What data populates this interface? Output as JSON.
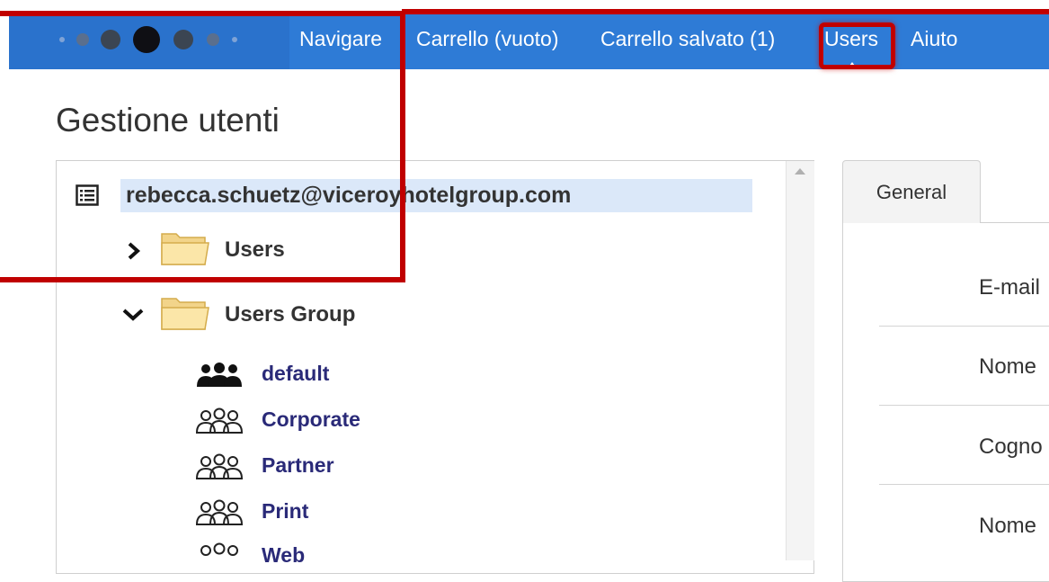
{
  "colors": {
    "nav_bg": "#2e7bd6",
    "callout": "#c00000",
    "selected_row": "#dbe8f9",
    "group_link": "#2a2a78"
  },
  "nav": {
    "items": [
      "Navigare",
      "Carrello (vuoto)",
      "Carrello salvato (1)",
      "Users",
      "Aiuto"
    ],
    "active": "Users"
  },
  "page_title": "Gestione utenti",
  "tree": {
    "root": {
      "label": "rebecca.schuetz@viceroyhotelgroup.com",
      "icon": "list-icon",
      "selected": true
    },
    "folders": [
      {
        "label": "Users",
        "expanded": false,
        "icon": "folder-icon"
      },
      {
        "label": "Users Group",
        "expanded": true,
        "icon": "folder-icon"
      }
    ],
    "groups": [
      {
        "label": "default",
        "icon": "group-filled-icon"
      },
      {
        "label": "Corporate",
        "icon": "group-outline-icon"
      },
      {
        "label": "Partner",
        "icon": "group-outline-icon"
      },
      {
        "label": "Print",
        "icon": "group-outline-icon"
      },
      {
        "label": "Web",
        "icon": "group-outline-icon"
      }
    ]
  },
  "details": {
    "tab": "General",
    "fields": [
      "E-mail",
      "Nome",
      "Cogno",
      "Nome"
    ]
  }
}
